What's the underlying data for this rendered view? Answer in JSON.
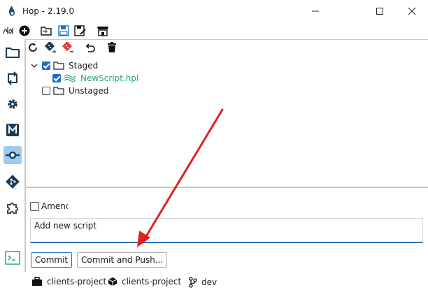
{
  "window": {
    "title": "Hop - 2.19.0",
    "controls": [
      "minimize-icon",
      "maximize-icon",
      "close-icon"
    ]
  },
  "toolbar": {
    "icons": [
      "hop-logo-icon",
      "new-icon",
      "open-folder-icon",
      "save-icon",
      "save-as-icon",
      "marketplace-icon"
    ]
  },
  "perspectives": [
    {
      "icon": "folder-icon",
      "active": false
    },
    {
      "icon": "pipeline-icon",
      "active": false
    },
    {
      "icon": "gear-icon",
      "active": false
    },
    {
      "icon": "metadata-icon",
      "active": false
    },
    {
      "icon": "execution-icon",
      "active": true
    },
    {
      "icon": "git-icon",
      "active": false
    },
    {
      "icon": "plugin-icon",
      "active": false
    },
    {
      "icon": "terminal-icon",
      "active": false
    }
  ],
  "git_toolbar": [
    "refresh-icon",
    "git-add-icon",
    "git-remove-icon",
    "revert-icon",
    "delete-icon"
  ],
  "tree": {
    "staged": {
      "label": "Staged",
      "checked": true,
      "expanded": true,
      "children": [
        {
          "label": "NewScript.hpl",
          "checked": true
        }
      ]
    },
    "unstaged": {
      "label": "Unstaged",
      "checked": false
    }
  },
  "commit": {
    "amend_label": "Amend",
    "amend_checked": false,
    "message": "Add new script",
    "commit_label": "Commit",
    "commit_push_label": "Commit and Push..."
  },
  "status": {
    "project": "clients-project",
    "environment": "clients-project",
    "branch": "dev"
  },
  "colors": {
    "accent": "#1a6fc8",
    "active_perspective": "#9ecbf0",
    "file_green": "#2aa58f",
    "arrow_red": "#e02020"
  }
}
